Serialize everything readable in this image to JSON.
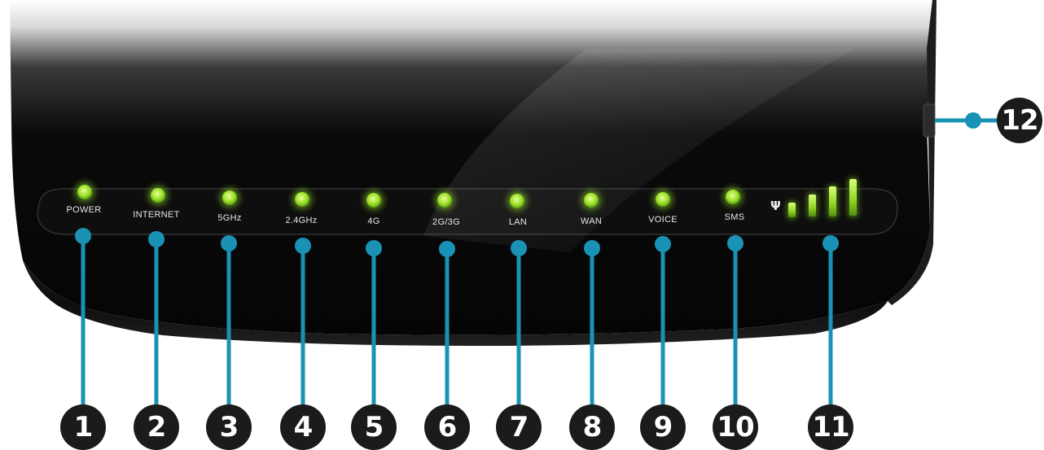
{
  "leds": [
    {
      "id": 1,
      "label": "POWER"
    },
    {
      "id": 2,
      "label": "INTERNET"
    },
    {
      "id": 3,
      "label": "5GHz"
    },
    {
      "id": 4,
      "label": "2.4GHz"
    },
    {
      "id": 5,
      "label": "4G"
    },
    {
      "id": 6,
      "label": "2G/3G"
    },
    {
      "id": 7,
      "label": "LAN"
    },
    {
      "id": 8,
      "label": "WAN"
    },
    {
      "id": 9,
      "label": "VOICE"
    },
    {
      "id": 10,
      "label": "SMS"
    }
  ],
  "signal_indicator": {
    "callout": "11",
    "bars": 4,
    "icon": "antenna-icon"
  },
  "side_button": {
    "callout": "12"
  },
  "callouts": [
    "1",
    "2",
    "3",
    "4",
    "5",
    "6",
    "7",
    "8",
    "9",
    "10",
    "11",
    "12"
  ],
  "colors": {
    "led_green": "#9ee02a",
    "leader_teal": "#1a92b5",
    "callout_fill": "#1b1b1b",
    "device_body": "#0b0b0b"
  }
}
